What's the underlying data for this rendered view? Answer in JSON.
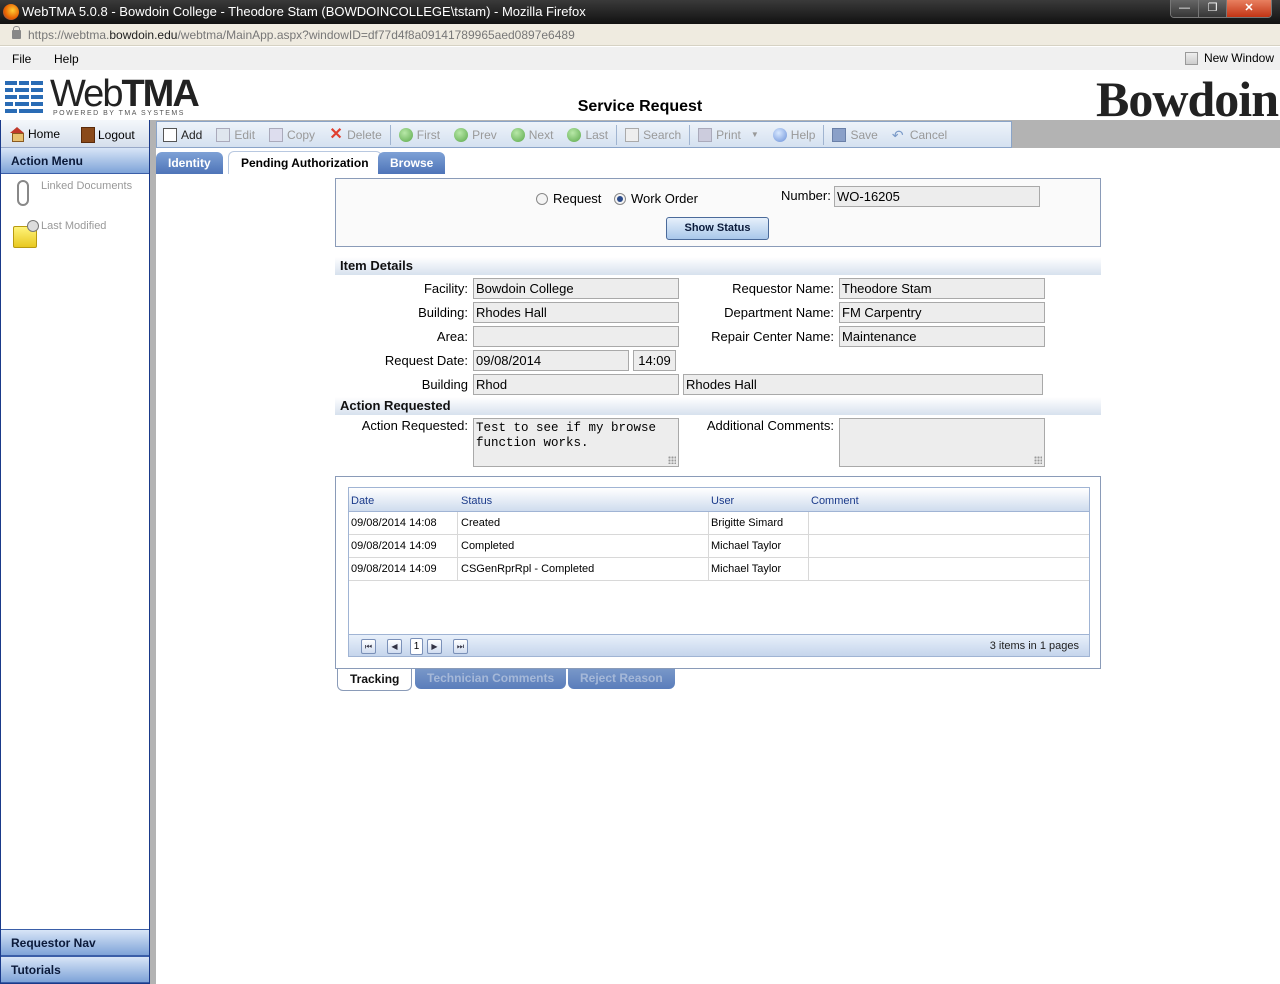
{
  "window": {
    "title": "WebTMA 5.0.8 - Bowdoin College - Theodore Stam (BOWDOINCOLLEGE\\tstam) - Mozilla Firefox",
    "buttons": {
      "minimize": "—",
      "restore": "❐",
      "close": "✕"
    }
  },
  "address_bar": {
    "url_prefix": "https://webtma.",
    "url_domain": "bowdoin.edu",
    "url_suffix": "/webtma/MainApp.aspx?windowID=df77d4f8a09141789965aed0897e6489"
  },
  "menu": {
    "items": [
      "File",
      "Help"
    ],
    "new_window_label": "New Window",
    "new_window_checked": false
  },
  "header": {
    "logo_text_light": "Web",
    "logo_text_bold": "TMA",
    "logo_sub": "POWERED BY TMA SYSTEMS",
    "page_title": "Service Request",
    "institution": "Bowdoin"
  },
  "leftnav": {
    "home": "Home",
    "logout": "Logout",
    "action_menu": "Action Menu",
    "items": [
      {
        "label": "Linked Documents",
        "icon": "paperclip-icon"
      },
      {
        "label": "Last Modified",
        "icon": "folder-clock-icon"
      }
    ],
    "bottom": [
      "Requestor Nav",
      "Tutorials"
    ]
  },
  "toolbar": {
    "buttons": [
      {
        "label": "Add",
        "enabled": true
      },
      {
        "label": "Edit",
        "enabled": false
      },
      {
        "label": "Copy",
        "enabled": false
      },
      {
        "label": "Delete",
        "enabled": false
      },
      {
        "label": "First",
        "enabled": false
      },
      {
        "label": "Prev",
        "enabled": false
      },
      {
        "label": "Next",
        "enabled": false
      },
      {
        "label": "Last",
        "enabled": false
      },
      {
        "label": "Search",
        "enabled": false
      },
      {
        "label": "Print",
        "enabled": false
      },
      {
        "label": "Help",
        "enabled": false
      },
      {
        "label": "Save",
        "enabled": false
      },
      {
        "label": "Cancel",
        "enabled": false
      }
    ]
  },
  "tabs": {
    "items": [
      "Identity",
      "Pending Authorization",
      "Browse"
    ],
    "active": "Pending Authorization"
  },
  "form": {
    "type_options": [
      "Request",
      "Work Order"
    ],
    "type_selected": "Work Order",
    "number_label": "Number:",
    "number_value": "WO-16205",
    "show_status_label": "Show Status",
    "item_details_heading": "Item Details",
    "facility_label": "Facility:",
    "facility_value": "Bowdoin College",
    "building_label": "Building:",
    "building_value": "Rhodes Hall",
    "area_label": "Area:",
    "area_value": "",
    "request_date_label": "Request Date:",
    "request_date_value": "09/08/2014",
    "request_time_value": "14:09",
    "building2_label": "Building",
    "building2_code": "Rhod",
    "building2_name": "Rhodes Hall",
    "requestor_name_label": "Requestor Name:",
    "requestor_name_value": "Theodore Stam",
    "department_name_label": "Department Name:",
    "department_name_value": "FM Carpentry",
    "repair_center_label": "Repair Center Name:",
    "repair_center_value": "Maintenance",
    "action_heading": "Action Requested",
    "action_requested_label": "Action Requested:",
    "action_requested_value": "Test to see if my browse function works.",
    "additional_comments_label": "Additional Comments:",
    "additional_comments_value": ""
  },
  "tracking": {
    "columns": [
      "Date",
      "Status",
      "User",
      "Comment"
    ],
    "rows": [
      {
        "date": "09/08/2014 14:08",
        "status": "Created",
        "user": "Brigitte Simard",
        "comment": ""
      },
      {
        "date": "09/08/2014 14:09",
        "status": "Completed",
        "user": "Michael Taylor",
        "comment": ""
      },
      {
        "date": "09/08/2014 14:09",
        "status": "CSGenRprRpl - Completed",
        "user": "Michael Taylor",
        "comment": ""
      }
    ],
    "pager": {
      "current_page": "1",
      "info": "3 items in 1 pages",
      "first": "⏮",
      "prev": "◀",
      "next": "▶",
      "last": "⏭"
    }
  },
  "bottom_tabs": {
    "items": [
      "Tracking",
      "Technician Comments",
      "Reject Reason"
    ],
    "active": "Tracking"
  }
}
